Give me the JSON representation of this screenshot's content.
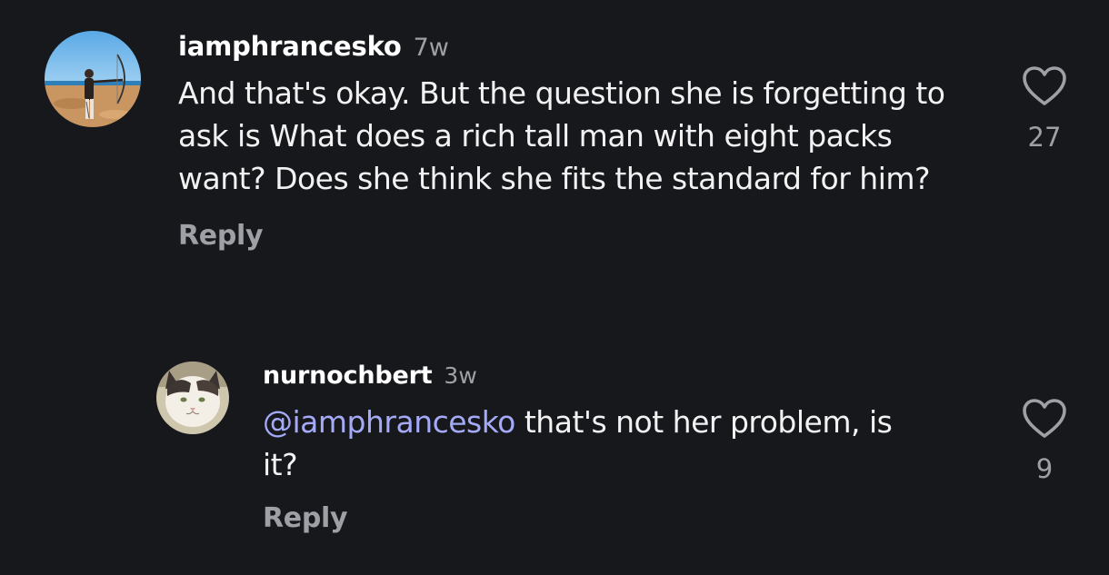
{
  "comments": [
    {
      "username": "iamphrancesko",
      "time": "7w",
      "text": "And that's okay. But the question she is forgetting to ask is What does a rich tall man with eight packs want? Does she think she fits the standard for him?",
      "reply_label": "Reply",
      "likes": "27",
      "avatar_icon": "archer-on-beach-photo"
    },
    {
      "username": "nurnochbert",
      "time": "3w",
      "mention": "@iamphrancesko",
      "text": " that's not her problem, is it?",
      "reply_label": "Reply",
      "likes": "9",
      "avatar_icon": "white-cat-photo"
    }
  ],
  "colors": {
    "background": "#17181c",
    "text": "#f2f2f3",
    "secondary": "#9ea0a6",
    "mention": "#a4aaf7"
  },
  "icons": {
    "like": "heart-outline-icon"
  }
}
